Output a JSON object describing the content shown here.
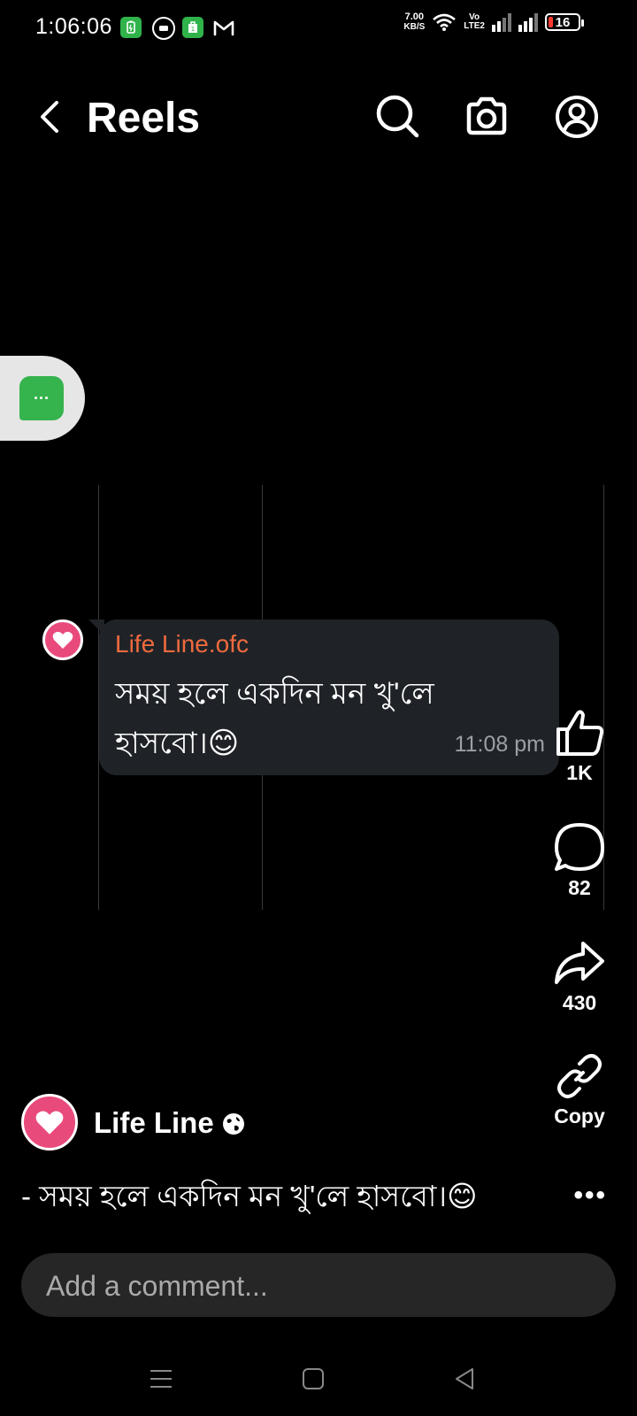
{
  "status_bar": {
    "time": "1:06:06",
    "net_speed_value": "7.00",
    "net_speed_unit": "KB/S",
    "volte_top": "Vo",
    "volte_bottom": "LTE2",
    "battery": "16"
  },
  "header": {
    "title": "Reels"
  },
  "chat_bubble": {
    "sender": "Life Line.ofc",
    "message": "সময় হলে একদিন মন খু'লে হাসবো।😊",
    "time": "11:08 pm"
  },
  "actions": {
    "like_count": "1K",
    "comment_count": "82",
    "share_count": "430",
    "copy_label": "Copy"
  },
  "author": {
    "name": "Life Line"
  },
  "caption": "- সময় হলে একদিন মন খু'লে হাসবো।😊",
  "more_label": "•••",
  "comment_box": {
    "placeholder": "Add a comment..."
  },
  "colors": {
    "accent_sender": "#ef6a3e",
    "avatar_pink": "#e94a7c",
    "chip_green": "#35b34d"
  }
}
